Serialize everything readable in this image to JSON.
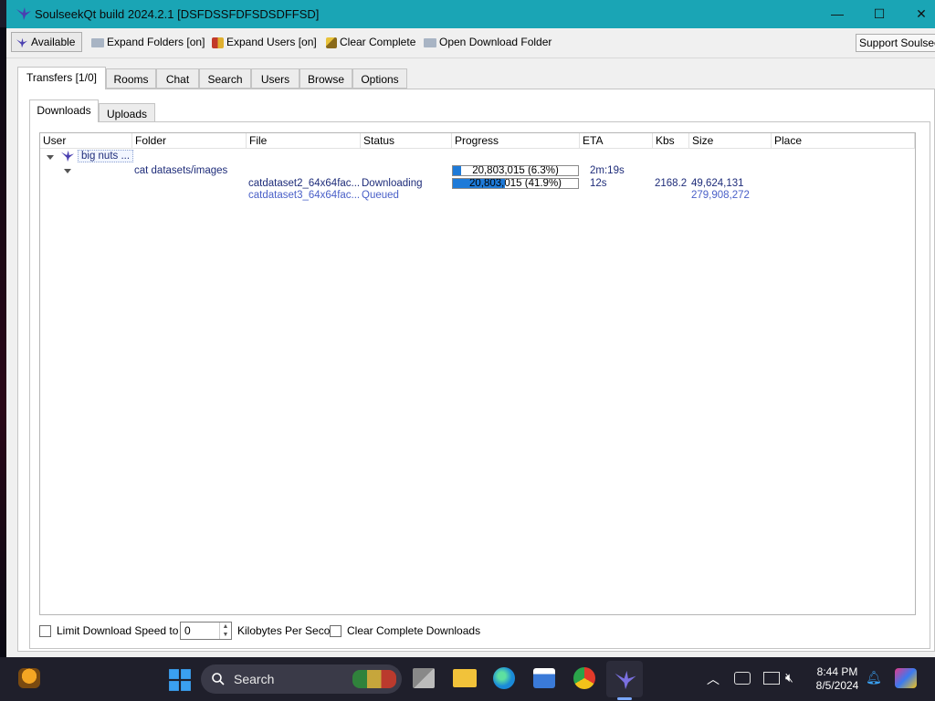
{
  "window": {
    "title": "SoulseekQt build 2024.2.1 [DSFDSSFDFSDSDFFSD]",
    "controls": {
      "minimize": "—",
      "maximize": "☐",
      "close": "✕"
    }
  },
  "toolbar": {
    "available": "Available",
    "expand_folders": "Expand Folders [on]",
    "expand_users": "Expand Users [on]",
    "clear_complete": "Clear Complete",
    "open_download_folder": "Open Download Folder",
    "support": "Support Soulseek"
  },
  "tabs": [
    "Transfers [1/0]",
    "Rooms",
    "Chat",
    "Search",
    "Users",
    "Browse",
    "Options"
  ],
  "subtabs": [
    "Downloads",
    "Uploads"
  ],
  "columns": [
    "User",
    "Folder",
    "File",
    "Status",
    "Progress",
    "ETA",
    "Kbs",
    "Size",
    "Place"
  ],
  "transfers": {
    "user": "big nuts ...",
    "folder": "cat datasets/images",
    "folder_progress": {
      "text": "20,803,015 (6.3%)",
      "fraction": 0.063
    },
    "folder_eta": "2m:19s",
    "folder_size": "",
    "files": [
      {
        "name": "catdataset2_64x64fac...",
        "status": "Downloading",
        "progress_text": "20,803,015 (41.9%)",
        "fraction": 0.419,
        "eta": "12s",
        "kbs": "2168.2",
        "size": "49,624,131"
      },
      {
        "name": "catdataset3_64x64fac...",
        "status": "Queued",
        "progress_text": "",
        "fraction": 0,
        "eta": "",
        "kbs": "",
        "size": "279,908,272"
      }
    ]
  },
  "bottom": {
    "limit_label": "Limit Download Speed to",
    "limit_value": "0",
    "unit": "Kilobytes Per Second",
    "clear_complete_downloads": "Clear Complete Downloads"
  },
  "taskbar": {
    "search_label": "Search",
    "time": "8:44 PM",
    "date": "8/5/2024"
  },
  "colors": {
    "titlebar": "#1aa5b5",
    "progress": "#1e7ad8",
    "text_blue": "#1f2d7a"
  }
}
